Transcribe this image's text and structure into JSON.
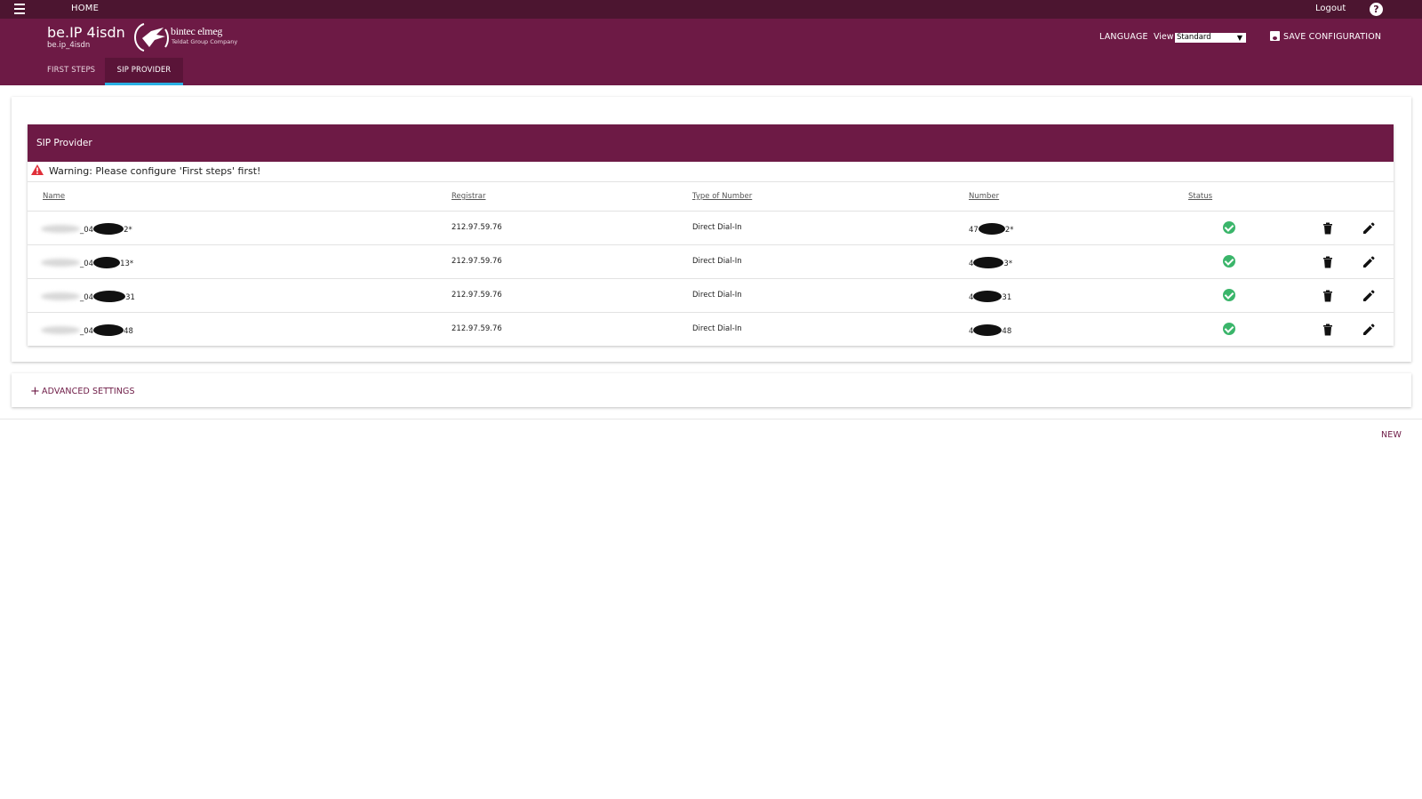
{
  "topbar": {
    "home_label": "HOME",
    "logout_label": "Logout",
    "help_label": "?"
  },
  "header": {
    "device_title": "be.IP 4isdn",
    "device_subtitle": "be.ip_4isdn",
    "logo_text": "bintec elmeg",
    "logo_tagline": "Teldat Group Company",
    "language_label": "LANGUAGE",
    "view_label": "View",
    "view_selected": "Standard",
    "save_label": "SAVE CONFIGURATION",
    "tabs": [
      {
        "label": "FIRST STEPS",
        "active": false
      },
      {
        "label": "SIP PROVIDER",
        "active": true
      }
    ]
  },
  "sip": {
    "title": "SIP Provider",
    "warning": "Warning: Please configure 'First steps' first!",
    "columns": [
      "Name",
      "Registrar",
      "Type of Number",
      "Number",
      "Status"
    ],
    "rows": [
      {
        "name_prefix": "_04",
        "name_suffix": "2*",
        "registrar": "212.97.59.76",
        "type": "Direct Dial-In",
        "number_prefix": "47",
        "number_suffix": "2*",
        "status": "ok"
      },
      {
        "name_prefix": "_04",
        "name_suffix": "13*",
        "registrar": "212.97.59.76",
        "type": "Direct Dial-In",
        "number_prefix": "4",
        "number_suffix": "3*",
        "status": "ok"
      },
      {
        "name_prefix": "_04",
        "name_suffix": "31",
        "registrar": "212.97.59.76",
        "type": "Direct Dial-In",
        "number_prefix": "4",
        "number_suffix": "31",
        "status": "ok"
      },
      {
        "name_prefix": "_04",
        "name_suffix": "48",
        "registrar": "212.97.59.76",
        "type": "Direct Dial-In",
        "number_prefix": "4",
        "number_suffix": "48",
        "status": "ok"
      }
    ]
  },
  "advanced": {
    "label": "ADVANCED SETTINGS"
  },
  "footer": {
    "new_label": "NEW"
  },
  "colors": {
    "brand": "#6d1a45",
    "topbar": "#4c1530",
    "tab_indicator": "#2ab0e4",
    "status_ok": "#3ab56a",
    "warning": "#e0303a"
  }
}
